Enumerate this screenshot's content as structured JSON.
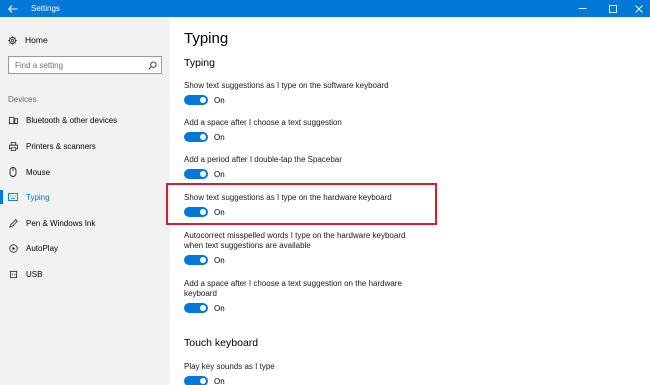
{
  "window": {
    "title": "Settings"
  },
  "sidebar": {
    "home_label": "Home",
    "search_placeholder": "Find a setting",
    "section_label": "Devices",
    "items": [
      {
        "label": "Bluetooth & other devices",
        "icon": "bluetooth-icon"
      },
      {
        "label": "Printers & scanners",
        "icon": "printer-icon"
      },
      {
        "label": "Mouse",
        "icon": "mouse-icon"
      },
      {
        "label": "Typing",
        "icon": "keyboard-icon",
        "active": true
      },
      {
        "label": "Pen & Windows Ink",
        "icon": "pen-icon"
      },
      {
        "label": "AutoPlay",
        "icon": "autoplay-icon"
      },
      {
        "label": "USB",
        "icon": "usb-icon"
      }
    ]
  },
  "main": {
    "title": "Typing",
    "section_typing": "Typing",
    "section_touch": "Touch keyboard",
    "settings": [
      {
        "text": "Show text suggestions as I type on the software keyboard",
        "state": "On"
      },
      {
        "text": "Add a space after I choose a text suggestion",
        "state": "On"
      },
      {
        "text": "Add a period after I double-tap the Spacebar",
        "state": "On"
      },
      {
        "text": "Show text suggestions as I type on the hardware keyboard",
        "state": "On"
      },
      {
        "text": "Autocorrect misspelled words I type on the hardware keyboard when text suggestions are available",
        "state": "On"
      },
      {
        "text": "Add a space after I choose a text suggestion on the hardware keyboard",
        "state": "On"
      },
      {
        "text": "Play key sounds as I type",
        "state": "On"
      }
    ]
  },
  "colors": {
    "accent": "#0078d7",
    "highlight": "#d41f2c",
    "sidebar_bg": "#f2f2f2"
  }
}
